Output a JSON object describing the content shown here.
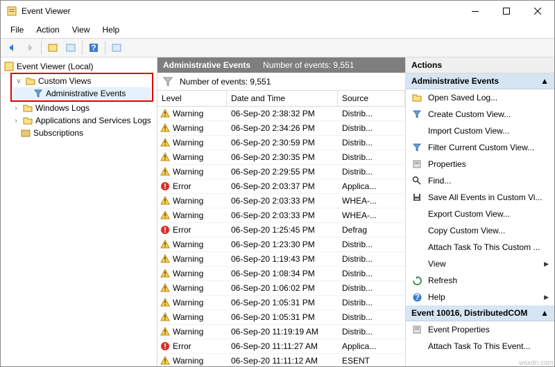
{
  "window": {
    "title": "Event Viewer"
  },
  "menu": [
    "File",
    "Action",
    "View",
    "Help"
  ],
  "tree": {
    "root": "Event Viewer (Local)",
    "customViews": "Custom Views",
    "adminEvents": "Administrative Events",
    "windowsLogs": "Windows Logs",
    "appsServices": "Applications and Services Logs",
    "subscriptions": "Subscriptions"
  },
  "center": {
    "title": "Administrative Events",
    "countLabel": "Number of events: 9,551",
    "filterLabel": "Number of events: 9,551",
    "cols": {
      "level": "Level",
      "dt": "Date and Time",
      "src": "Source"
    },
    "rows": [
      {
        "level": "Warning",
        "icon": "warn",
        "dt": "06-Sep-20 2:38:32 PM",
        "src": "Distrib..."
      },
      {
        "level": "Warning",
        "icon": "warn",
        "dt": "06-Sep-20 2:34:26 PM",
        "src": "Distrib..."
      },
      {
        "level": "Warning",
        "icon": "warn",
        "dt": "06-Sep-20 2:30:59 PM",
        "src": "Distrib..."
      },
      {
        "level": "Warning",
        "icon": "warn",
        "dt": "06-Sep-20 2:30:35 PM",
        "src": "Distrib..."
      },
      {
        "level": "Warning",
        "icon": "warn",
        "dt": "06-Sep-20 2:29:55 PM",
        "src": "Distrib..."
      },
      {
        "level": "Error",
        "icon": "err",
        "dt": "06-Sep-20 2:03:37 PM",
        "src": "Applica..."
      },
      {
        "level": "Warning",
        "icon": "warn",
        "dt": "06-Sep-20 2:03:33 PM",
        "src": "WHEA-..."
      },
      {
        "level": "Warning",
        "icon": "warn",
        "dt": "06-Sep-20 2:03:33 PM",
        "src": "WHEA-..."
      },
      {
        "level": "Error",
        "icon": "err",
        "dt": "06-Sep-20 1:25:45 PM",
        "src": "Defrag"
      },
      {
        "level": "Warning",
        "icon": "warn",
        "dt": "06-Sep-20 1:23:30 PM",
        "src": "Distrib..."
      },
      {
        "level": "Warning",
        "icon": "warn",
        "dt": "06-Sep-20 1:19:43 PM",
        "src": "Distrib..."
      },
      {
        "level": "Warning",
        "icon": "warn",
        "dt": "06-Sep-20 1:08:34 PM",
        "src": "Distrib..."
      },
      {
        "level": "Warning",
        "icon": "warn",
        "dt": "06-Sep-20 1:06:02 PM",
        "src": "Distrib..."
      },
      {
        "level": "Warning",
        "icon": "warn",
        "dt": "06-Sep-20 1:05:31 PM",
        "src": "Distrib..."
      },
      {
        "level": "Warning",
        "icon": "warn",
        "dt": "06-Sep-20 1:05:31 PM",
        "src": "Distrib..."
      },
      {
        "level": "Warning",
        "icon": "warn",
        "dt": "06-Sep-20 11:19:19 AM",
        "src": "Distrib..."
      },
      {
        "level": "Error",
        "icon": "err",
        "dt": "06-Sep-20 11:11:27 AM",
        "src": "Applica..."
      },
      {
        "level": "Warning",
        "icon": "warn",
        "dt": "06-Sep-20 11:11:12 AM",
        "src": "ESENT"
      }
    ]
  },
  "actions": {
    "paneTitle": "Actions",
    "section1": "Administrative Events",
    "items1": [
      {
        "icon": "open",
        "label": "Open Saved Log..."
      },
      {
        "icon": "filter",
        "label": "Create Custom View..."
      },
      {
        "icon": "",
        "label": "Import Custom View..."
      },
      {
        "icon": "filter",
        "label": "Filter Current Custom View..."
      },
      {
        "icon": "props",
        "label": "Properties"
      },
      {
        "icon": "find",
        "label": "Find..."
      },
      {
        "icon": "save",
        "label": "Save All Events in Custom Vi..."
      },
      {
        "icon": "",
        "label": "Export Custom View..."
      },
      {
        "icon": "",
        "label": "Copy Custom View..."
      },
      {
        "icon": "",
        "label": "Attach Task To This Custom ..."
      },
      {
        "icon": "",
        "label": "View",
        "submenu": true
      },
      {
        "icon": "refresh",
        "label": "Refresh"
      },
      {
        "icon": "help",
        "label": "Help",
        "submenu": true
      }
    ],
    "section2": "Event 10016, DistributedCOM",
    "items2": [
      {
        "icon": "props",
        "label": "Event Properties"
      },
      {
        "icon": "",
        "label": "Attach Task To This Event..."
      }
    ]
  },
  "watermark": "wsxdn.com"
}
